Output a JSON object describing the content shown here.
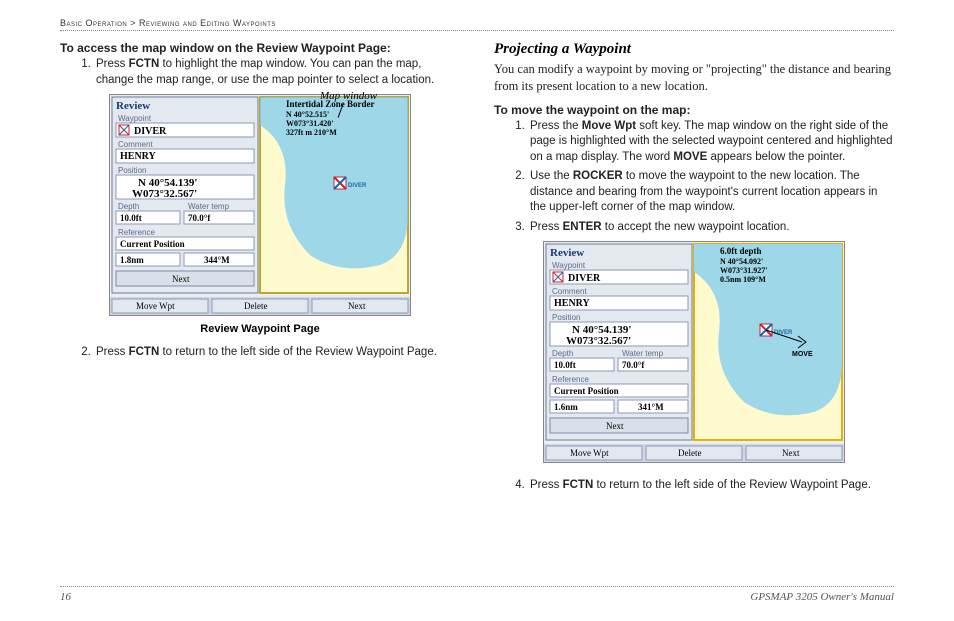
{
  "breadcrumb": {
    "section": "Basic Operation",
    "sub": "Reviewing and Editing Waypoints"
  },
  "left": {
    "title": "To access the map window on the Review Waypoint Page:",
    "step1_pre": "Press ",
    "step1_b": "FCTN",
    "step1_post": " to highlight the map window. You can pan the map, change the map range, or use the map pointer to select a location.",
    "map_window_label": "Map window",
    "caption": "Review Waypoint Page",
    "step2_pre": "Press ",
    "step2_b": "FCTN",
    "step2_post": " to return to the left side of the Review Waypoint Page.",
    "shot": {
      "title": "Review",
      "waypoint_label": "Waypoint",
      "waypoint_name": "DIVER",
      "comment_label": "Comment",
      "comment_value": "HENRY",
      "position_label": "Position",
      "position_value1": "N  40°54.139'",
      "position_value2": "W073°32.567'",
      "depth_label": "Depth",
      "depth_value": "10.0ft",
      "wtemp_label": "Water temp",
      "wtemp_value": "70.0°f",
      "reference_label": "Reference",
      "reference_value": "Current Position",
      "dist": "1.8nm",
      "bearing": "344°M",
      "next_btn": "Next",
      "btn1": "Move Wpt",
      "btn2": "Delete",
      "btn3": "Next",
      "map_title": "Intertidal Zone Border",
      "map_line1": "N  40°52.515'",
      "map_line2": "W073°31.420'",
      "map_line3": "327ft  m 210°M"
    }
  },
  "right": {
    "heading": "Projecting a Waypoint",
    "body": "You can modify a waypoint by moving or \"projecting\" the distance and bearing from its present location to a new location.",
    "title": "To move the waypoint on the map:",
    "s1_a": "Press the ",
    "s1_b": "Move Wpt",
    "s1_c": " soft key. The map window on the right side of the page is highlighted with the selected waypoint centered and highlighted on a map display. The word ",
    "s1_d": "MOVE",
    "s1_e": " appears below the pointer.",
    "s2_a": "Use the ",
    "s2_b": "ROCKER",
    "s2_c": " to move the waypoint to the new location. The distance and bearing from the waypoint's current location appears in the upper-left corner of the map window.",
    "s3_a": "Press ",
    "s3_b": "ENTER",
    "s3_c": " to accept the new waypoint location.",
    "s4_a": "Press ",
    "s4_b": "FCTN",
    "s4_c": " to return to the left side of the Review Waypoint Page.",
    "shot": {
      "title": "Review",
      "waypoint_label": "Waypoint",
      "waypoint_name": "DIVER",
      "comment_label": "Comment",
      "comment_value": "HENRY",
      "position_label": "Position",
      "position_value1": "N  40°54.139'",
      "position_value2": "W073°32.567'",
      "depth_label": "Depth",
      "depth_value": "10.0ft",
      "wtemp_label": "Water temp",
      "wtemp_value": "70.0°f",
      "reference_label": "Reference",
      "reference_value": "Current Position",
      "dist": "1.6nm",
      "bearing": "341°M",
      "next_btn": "Next",
      "btn1": "Move Wpt",
      "btn2": "Delete",
      "btn3": "Next",
      "map_title": "6.0ft  depth",
      "map_line1": "N  40°54.092'",
      "map_line2": "W073°31.927'",
      "map_line3": "0.5nm  109°M",
      "move_label": "MOVE"
    }
  },
  "footer": {
    "page": "16",
    "manual": "GPSMAP 3205 Owner's Manual"
  }
}
